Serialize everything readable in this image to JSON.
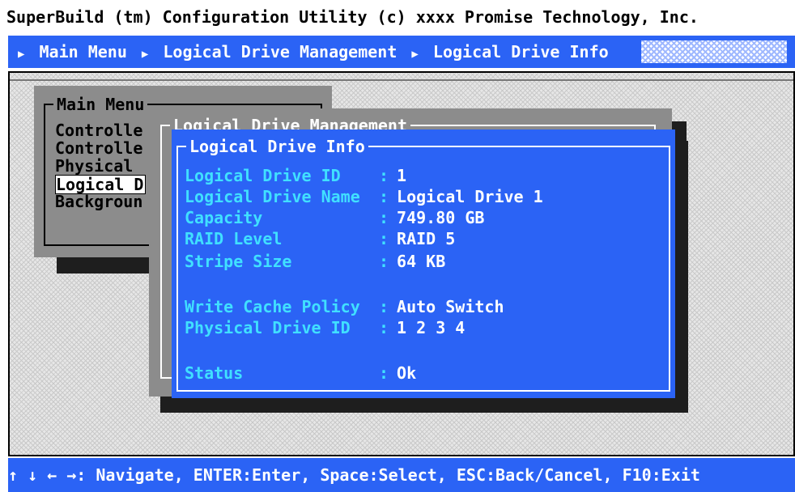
{
  "app": {
    "title": "SuperBuild (tm) Configuration Utility (c) xxxx Promise Technology, Inc."
  },
  "breadcrumb": {
    "items": [
      "Main Menu",
      "Logical Drive Management",
      "Logical Drive Info"
    ]
  },
  "main_menu": {
    "title": "Main Menu",
    "items": [
      "Controlle",
      "Controlle",
      "Physical",
      "Logical D",
      "Backgroun"
    ],
    "selected_index": 3
  },
  "ldm_window": {
    "title": "Logical Drive Management"
  },
  "info_window": {
    "title": "Logical Drive Info",
    "fields": [
      {
        "label": "Logical Drive ID",
        "value": "1"
      },
      {
        "label": "Logical Drive Name",
        "value": "Logical Drive 1"
      },
      {
        "label": "Capacity",
        "value": "749.80 GB"
      },
      {
        "label": "RAID Level",
        "value": "RAID 5"
      },
      {
        "label": "Stripe Size",
        "value": "64 KB"
      },
      {
        "label": "Write Cache Policy",
        "value": "Auto Switch"
      },
      {
        "label": "Physical Drive ID",
        "value": "1 2 3 4"
      },
      {
        "label": "Status",
        "value": "Ok"
      }
    ],
    "separator": ":"
  },
  "status_bar": {
    "text": "↑ ↓ ← →: Navigate, ENTER:Enter, Space:Select, ESC:Back/Cancel, F10:Exit"
  },
  "colors": {
    "blue": "#2b63f5",
    "label_cyan": "#40e0ff",
    "window_gray": "#8c8c8c",
    "shadow": "#1e1e1e"
  }
}
